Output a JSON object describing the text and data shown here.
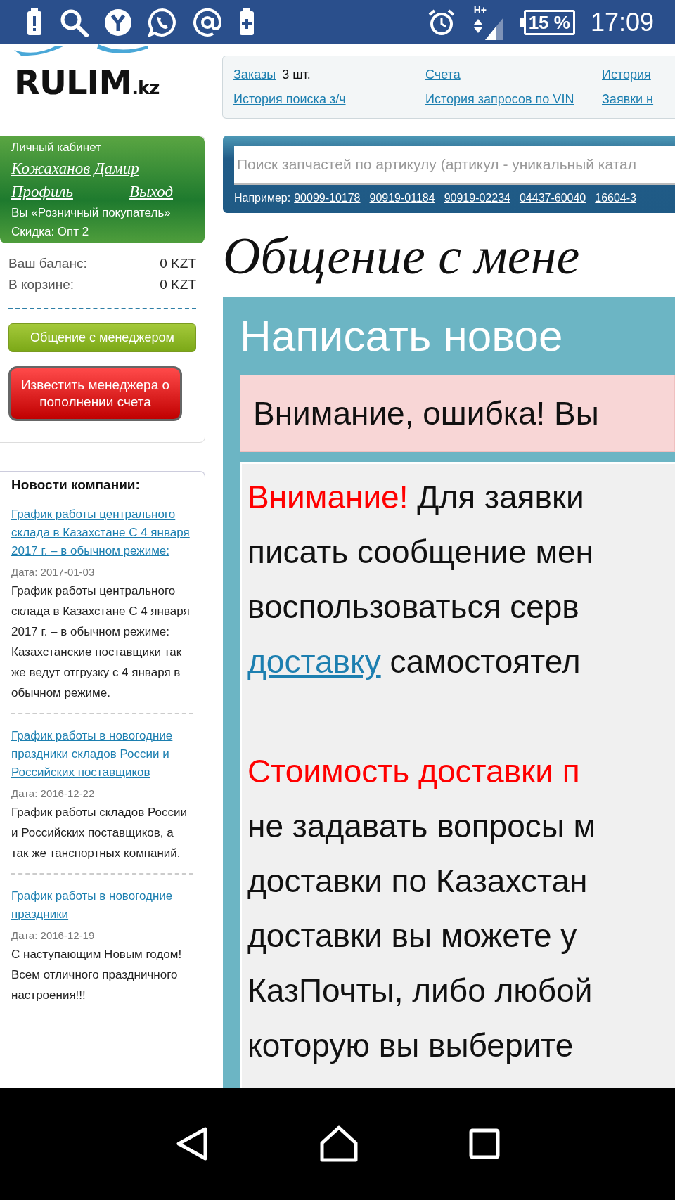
{
  "status_bar": {
    "network": "H+",
    "battery": "15 %",
    "time": "17:09"
  },
  "header": {
    "logo": "RULIM",
    "logo_suffix": ".kz",
    "links": [
      {
        "label": "Заказы",
        "suffix": "3 шт."
      },
      {
        "label": "Счета"
      },
      {
        "label": "История"
      },
      {
        "label": "История поиска з/ч"
      },
      {
        "label": "История запросов по VIN"
      },
      {
        "label": "Заявки н"
      }
    ]
  },
  "account": {
    "title": "Личный кабинет",
    "name": "Кожаханов Дамир",
    "profile": "Профиль",
    "logout": "Выход",
    "role": "Вы «Розничный покупатель»",
    "discount": "Скидка: Опт 2",
    "totals": [
      {
        "label": "Ваш баланс:",
        "value": "0 KZT"
      },
      {
        "label": "В корзине:",
        "value": "0 KZT"
      }
    ],
    "chat_button": "Общение с менеджером",
    "notify_button": "Известить менеджера о пополнении счета"
  },
  "news": {
    "title": "Новости компании:",
    "items": [
      {
        "title": "График работы центрального склада в Казахстане С 4 января 2017 г. – в обычном режиме:",
        "date": "Дата: 2017-01-03",
        "text": "График работы центрального склада в Казахстане С 4 января 2017 г. – в обычном режиме: Казахстанские поставщики так же ведут отгрузку с 4 января в обычном режиме."
      },
      {
        "title": "График работы в новогодние праздники складов России и Российских поставщиков",
        "date": "Дата: 2016-12-22",
        "text": "График работы складов России и Российских поставщиков, а так же танспортных компаний."
      },
      {
        "title": "График работы в новогодние праздники",
        "date": "Дата: 2016-12-19",
        "text": "С наступающим Новым годом! Всем отличного праздничного настроения!!!"
      }
    ]
  },
  "search": {
    "placeholder": "Поиск запчастей по артикулу (артикул - уникальный катал",
    "example_label": "Например:",
    "examples": [
      "90099-10178",
      "90919-01184",
      "90919-02234",
      "04437-60040",
      "16604-3"
    ]
  },
  "main": {
    "heading": "Общение с мене",
    "panel_title": "Написать новое",
    "error": "Внимание, ошибка! Вы",
    "paragraphs": [
      [
        [
          {
            "kind": "warning",
            "text": "Внимание!"
          },
          {
            "kind": "plain",
            "text": " Для заявки"
          }
        ],
        [
          {
            "kind": "plain",
            "text": "писать сообщение мен"
          }
        ],
        [
          {
            "kind": "plain",
            "text": "воспользоваться серв"
          }
        ],
        [
          {
            "kind": "link",
            "text": "доставку"
          },
          {
            "kind": "plain",
            "text": " самостоятел"
          }
        ]
      ],
      [
        [
          {
            "kind": "warning",
            "text": "Стоимость доставки п"
          }
        ],
        [
          {
            "kind": "plain",
            "text": "не задавать вопросы м"
          }
        ],
        [
          {
            "kind": "plain",
            "text": "доставки по Казахстан"
          }
        ],
        [
          {
            "kind": "plain",
            "text": "доставки вы можете у"
          }
        ],
        [
          {
            "kind": "plain",
            "text": "КазПочты, либо любой"
          }
        ],
        [
          {
            "kind": "plain",
            "text": "которую вы выберите"
          }
        ]
      ]
    ]
  }
}
